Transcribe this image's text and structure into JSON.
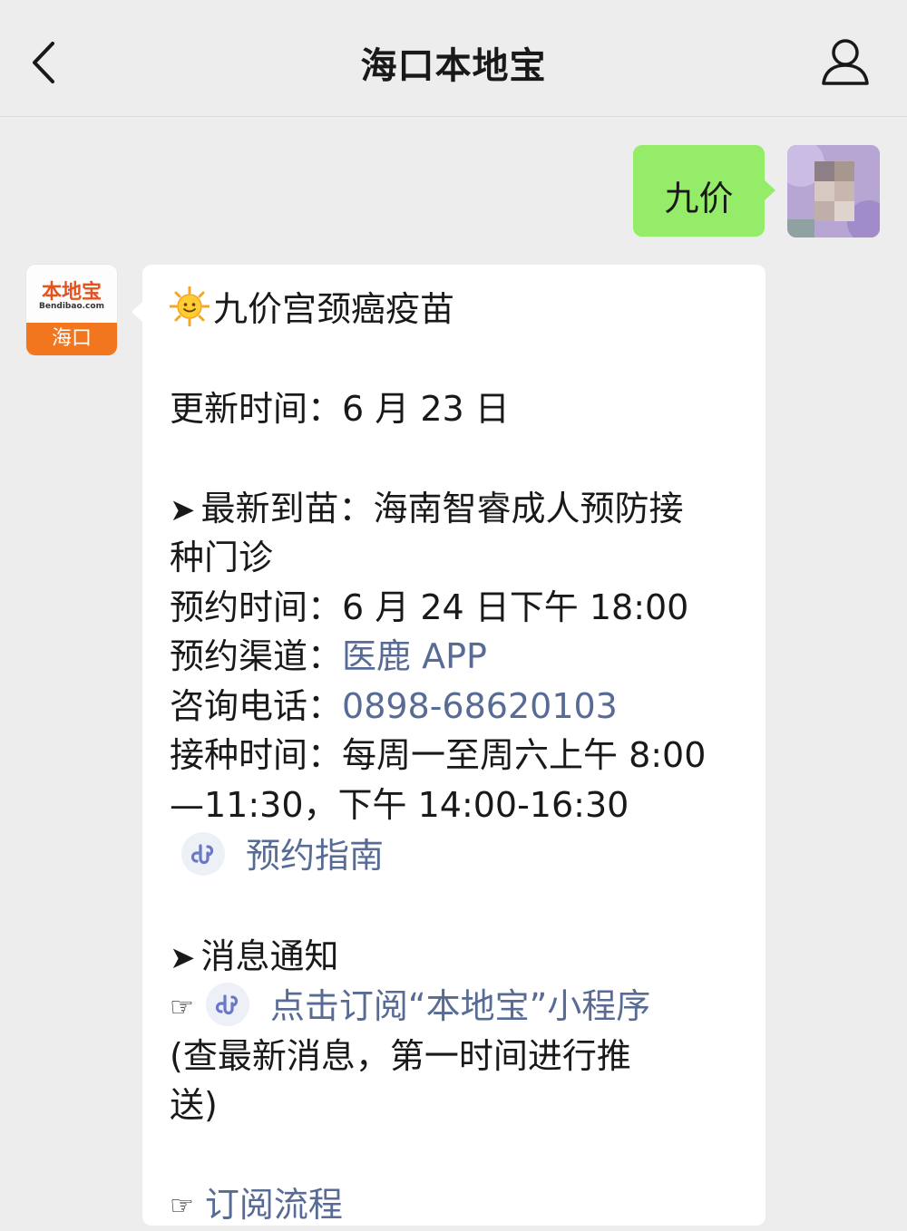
{
  "header": {
    "title": "海口本地宝"
  },
  "chat": {
    "user_message": "九价",
    "bot_avatar": {
      "logo_name": "本地宝",
      "domain": "Bendibao.com",
      "city": "海口"
    },
    "bot_message": {
      "heading": "九价宫颈癌疫苗",
      "update_time": "更新时间：6 月 23 日",
      "latest_prefix": "最新到苗：海南智睿成人预防接",
      "latest_suffix": "种门诊",
      "booking_time": "预约时间：6 月 24 日下午 18:00",
      "channel_label": "预约渠道：",
      "channel_value": "医鹿 APP",
      "phone_label": "咨询电话：",
      "phone_value": "0898-68620103",
      "vaccination_time_1": "接种时间：每周一至周六上午 8:00",
      "vaccination_time_2": "—11:30，下午 14:00-16:30",
      "guide_link": "预约指南",
      "notice_heading": "消息通知",
      "subscribe_link": "点击订阅“本地宝”小程序",
      "subscribe_note_1": "(查最新消息，第一时间进行推",
      "subscribe_note_2": "送)",
      "subscribe_flow_link": "订阅流程"
    }
  },
  "colors": {
    "background": "#ededed",
    "user_bubble": "#95ec69",
    "link": "#576b95",
    "brand_orange": "#f2761e"
  },
  "icons": {
    "back": "chevron-left-icon",
    "profile": "person-icon",
    "sun": "sun-emoji-icon",
    "mini_program": "mini-program-icon",
    "arrow": "arrow-right-icon",
    "pointing_hand": "pointing-hand-icon"
  }
}
